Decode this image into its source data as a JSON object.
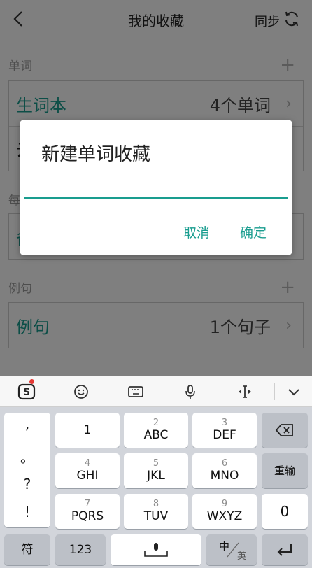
{
  "header": {
    "title": "我的收藏",
    "sync_label": "同步"
  },
  "sections": [
    {
      "label": "单词",
      "plus": "+",
      "rows": [
        {
          "name": "生词本",
          "count": "4个单词",
          "chevron": "›"
        },
        {
          "name": "云",
          "count": "",
          "chevron": ""
        }
      ]
    },
    {
      "label": "每",
      "plus": "",
      "rows": [
        {
          "name": "备",
          "count": "",
          "chevron": ""
        }
      ]
    },
    {
      "label": "例句",
      "plus": "+",
      "rows": [
        {
          "name": "例句",
          "count": "1个句子",
          "chevron": "›"
        }
      ]
    }
  ],
  "dialog": {
    "title": "新建单词收藏",
    "input_value": "",
    "cancel_label": "取消",
    "ok_label": "确定"
  },
  "keyboard": {
    "punctuation": [
      ",",
      "。",
      "?",
      "!"
    ],
    "keys": [
      {
        "num": "",
        "main": "1"
      },
      {
        "num": "2",
        "main": "ABC"
      },
      {
        "num": "3",
        "main": "DEF"
      },
      {
        "num": "4",
        "main": "GHI"
      },
      {
        "num": "5",
        "main": "JKL"
      },
      {
        "num": "6",
        "main": "MNO"
      },
      {
        "num": "7",
        "main": "PQRS"
      },
      {
        "num": "8",
        "main": "TUV"
      },
      {
        "num": "9",
        "main": "WXYZ"
      }
    ],
    "reinput_label": "重输",
    "zero_label": "0",
    "symbol_label": "符",
    "numeric_label": "123",
    "lang_zh": "中",
    "lang_en": "英"
  },
  "colors": {
    "accent": "#199d8f",
    "overlay": "rgba(0,0,0,0.5)",
    "keyboard_bg": "#d2d5db"
  },
  "icons": [
    "back-arrow-icon",
    "sync-icon",
    "chevron-right-icon",
    "sogou-logo-icon",
    "emoji-icon",
    "keyboard-icon",
    "microphone-icon",
    "cursor-move-icon",
    "collapse-keyboard-icon",
    "backspace-icon",
    "space-mic-icon",
    "enter-icon"
  ]
}
